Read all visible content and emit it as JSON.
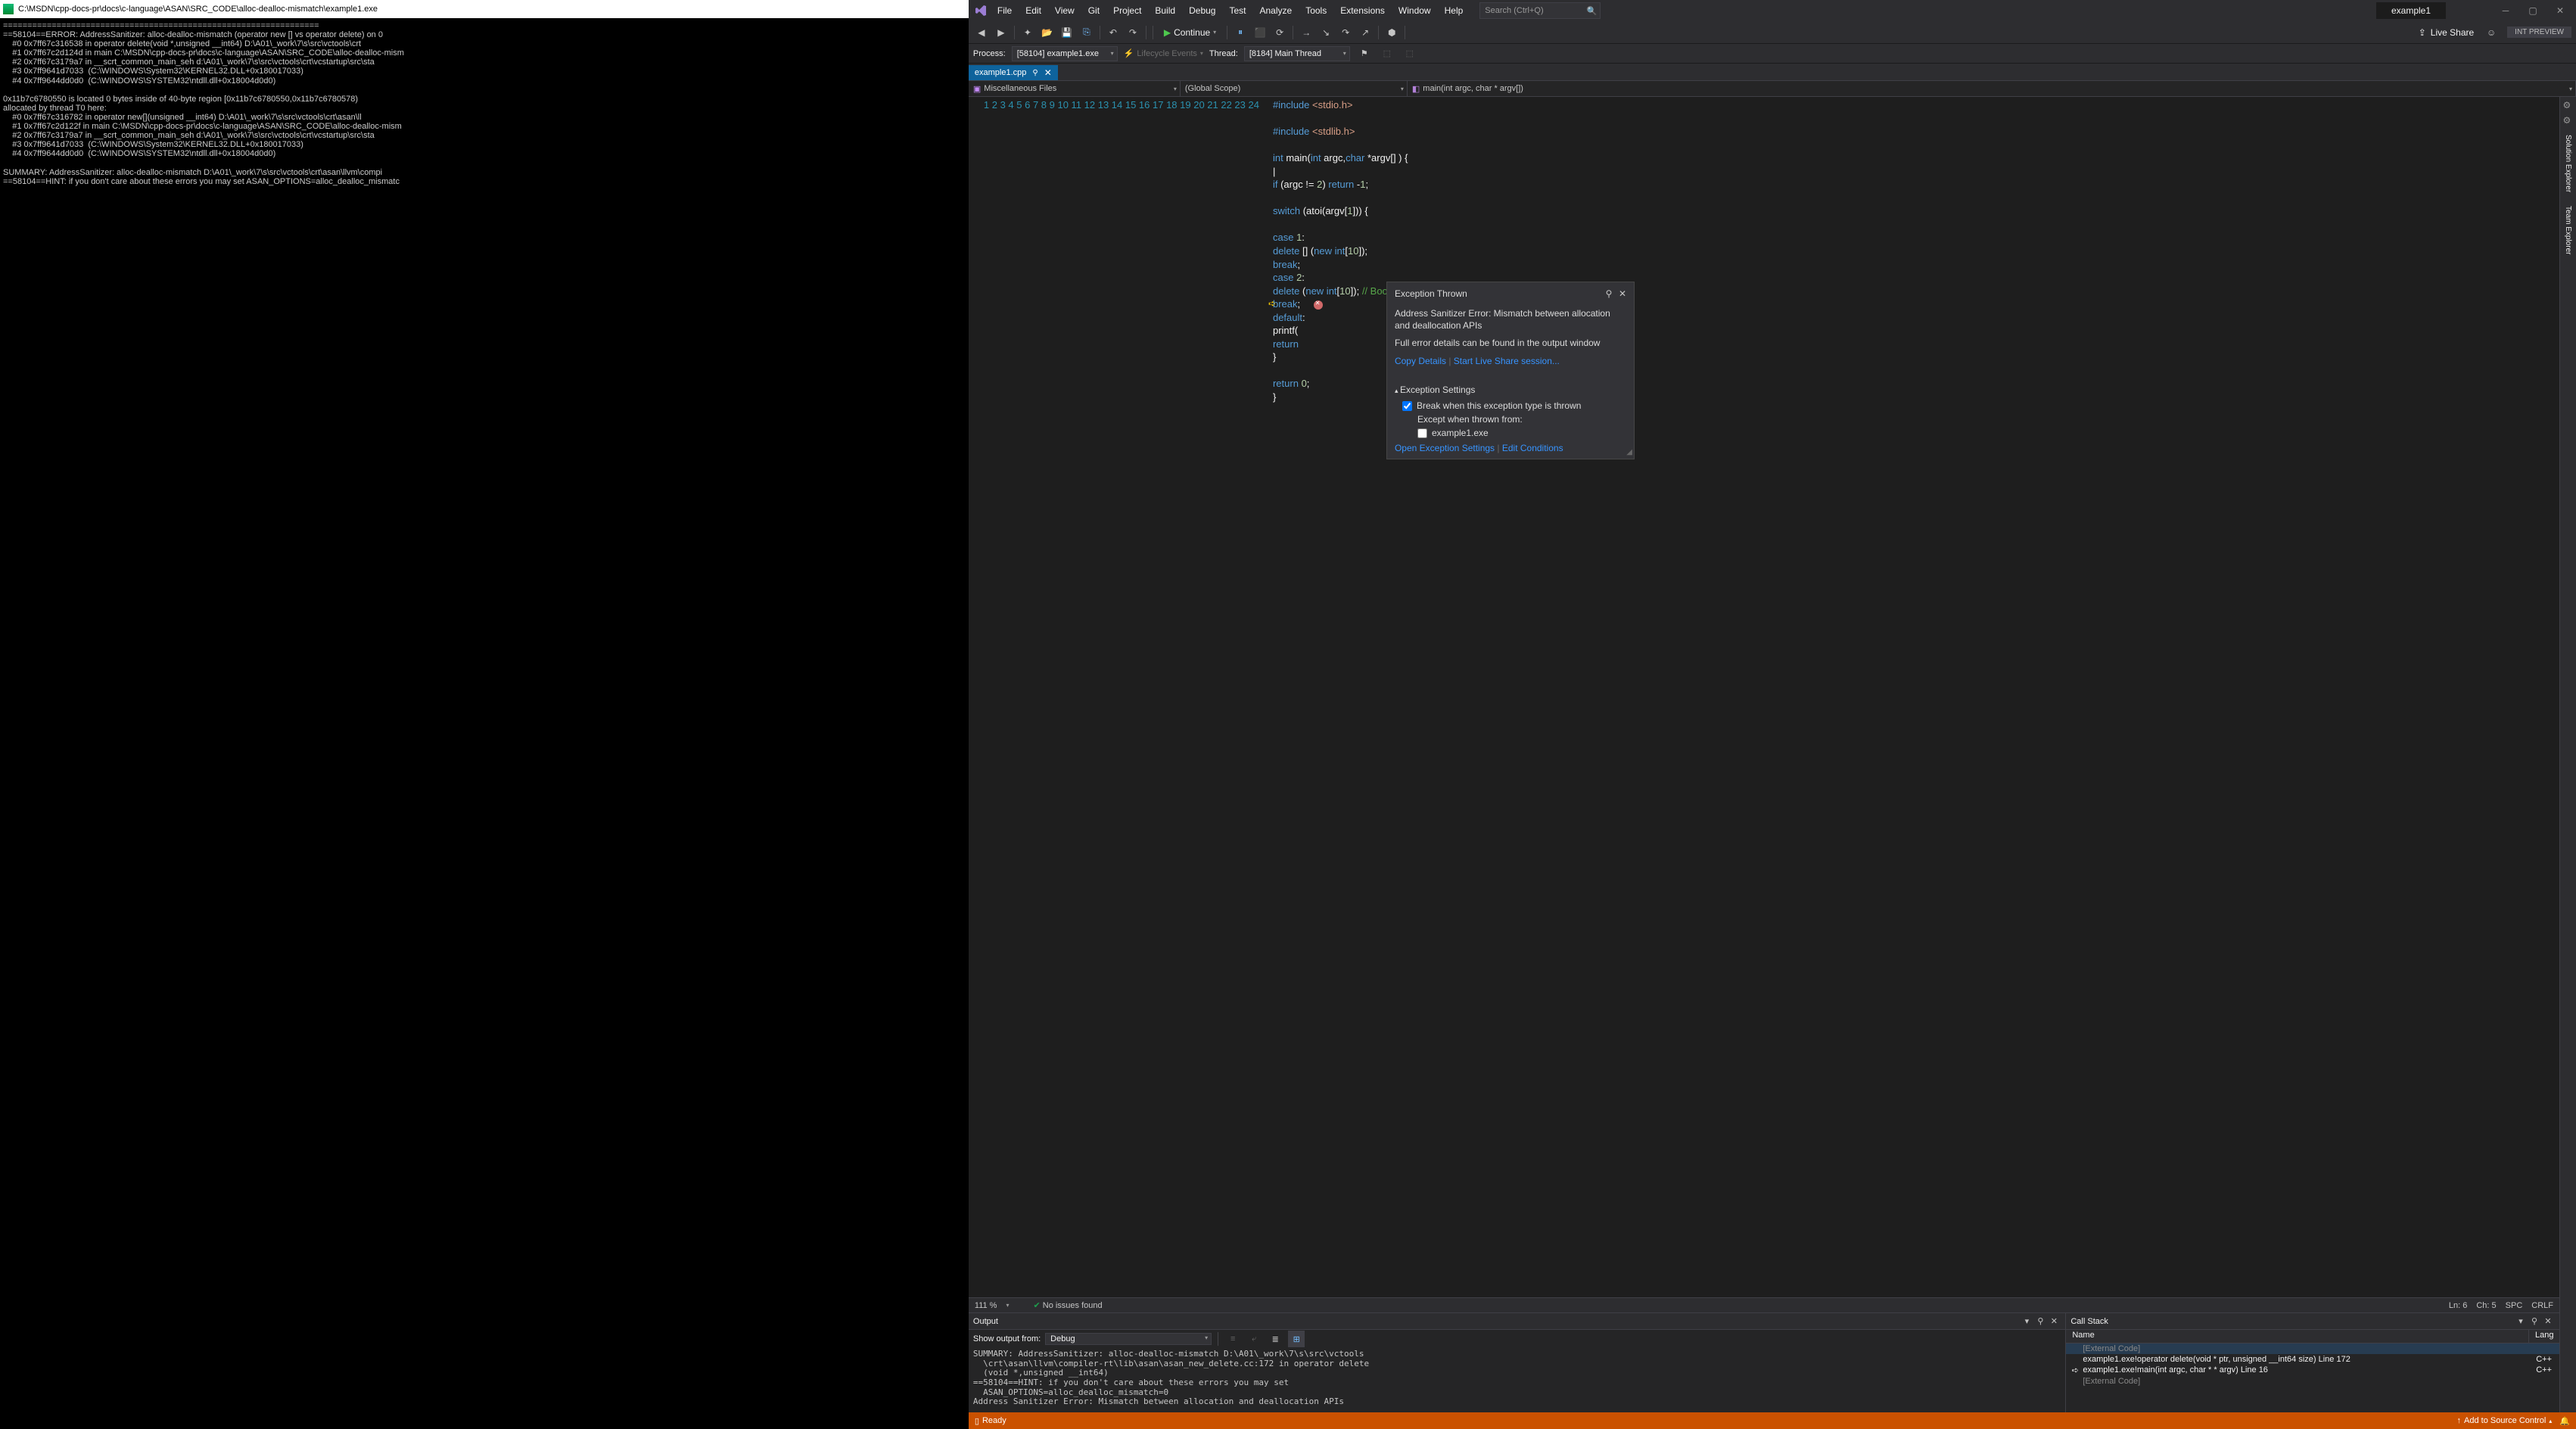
{
  "console": {
    "title": "C:\\MSDN\\cpp-docs-pr\\docs\\c-language\\ASAN\\SRC_CODE\\alloc-dealloc-mismatch\\example1.exe",
    "body": "=================================================================\n==58104==ERROR: AddressSanitizer: alloc-dealloc-mismatch (operator new [] vs operator delete) on 0\n    #0 0x7ff67c316538 in operator delete(void *,unsigned __int64) D:\\A01\\_work\\7\\s\\src\\vctools\\crt\n    #1 0x7ff67c2d124d in main C:\\MSDN\\cpp-docs-pr\\docs\\c-language\\ASAN\\SRC_CODE\\alloc-dealloc-mism\n    #2 0x7ff67c3179a7 in __scrt_common_main_seh d:\\A01\\_work\\7\\s\\src\\vctools\\crt\\vcstartup\\src\\sta\n    #3 0x7ff9641d7033  (C:\\WINDOWS\\System32\\KERNEL32.DLL+0x180017033)\n    #4 0x7ff9644dd0d0  (C:\\WINDOWS\\SYSTEM32\\ntdll.dll+0x18004d0d0)\n\n0x11b7c6780550 is located 0 bytes inside of 40-byte region [0x11b7c6780550,0x11b7c6780578)\nallocated by thread T0 here:\n    #0 0x7ff67c316782 in operator new[](unsigned __int64) D:\\A01\\_work\\7\\s\\src\\vctools\\crt\\asan\\ll\n    #1 0x7ff67c2d122f in main C:\\MSDN\\cpp-docs-pr\\docs\\c-language\\ASAN\\SRC_CODE\\alloc-dealloc-mism\n    #2 0x7ff67c3179a7 in __scrt_common_main_seh d:\\A01\\_work\\7\\s\\src\\vctools\\crt\\vcstartup\\src\\sta\n    #3 0x7ff9641d7033  (C:\\WINDOWS\\System32\\KERNEL32.DLL+0x180017033)\n    #4 0x7ff9644dd0d0  (C:\\WINDOWS\\SYSTEM32\\ntdll.dll+0x18004d0d0)\n\nSUMMARY: AddressSanitizer: alloc-dealloc-mismatch D:\\A01\\_work\\7\\s\\src\\vctools\\crt\\asan\\llvm\\compi\n==58104==HINT: if you don't care about these errors you may set ASAN_OPTIONS=alloc_dealloc_mismatc"
  },
  "menu": {
    "items": [
      "File",
      "Edit",
      "View",
      "Git",
      "Project",
      "Build",
      "Debug",
      "Test",
      "Analyze",
      "Tools",
      "Extensions",
      "Window",
      "Help"
    ],
    "search_placeholder": "Search (Ctrl+Q)",
    "solution_name": "example1"
  },
  "toolbar": {
    "continue_label": "Continue",
    "liveshare_label": "Live Share",
    "intpreview_label": "INT PREVIEW"
  },
  "processbar": {
    "process_label": "Process:",
    "process_value": "[58104] example1.exe",
    "lifecycle_label": "Lifecycle Events",
    "thread_label": "Thread:",
    "thread_value": "[8184] Main Thread"
  },
  "tab": {
    "filename": "example1.cpp"
  },
  "context": {
    "project": "Miscellaneous Files",
    "scope": "(Global Scope)",
    "function": "main(int argc, char * argv[])"
  },
  "code": {
    "lines": [
      {
        "n": 1,
        "html": "<span class='kw'>#include</span> <span class='str'>&lt;stdio.h&gt;</span>"
      },
      {
        "n": 2,
        "html": ""
      },
      {
        "n": 3,
        "html": "<span class='kw'>#include</span> <span class='str'>&lt;stdlib.h&gt;</span>"
      },
      {
        "n": 4,
        "html": ""
      },
      {
        "n": 5,
        "html": "<span class='kw'>int</span> main(<span class='kw'>int</span> argc,<span class='kw'>char</span> *argv[] ) {"
      },
      {
        "n": 6,
        "html": "  |"
      },
      {
        "n": 7,
        "html": "    <span class='kw'>if</span> (argc != <span class='num'>2</span>) <span class='kw'>return</span> -<span class='num'>1</span>;"
      },
      {
        "n": 8,
        "html": ""
      },
      {
        "n": 9,
        "html": "    <span class='kw'>switch</span> (atoi(argv[<span class='num'>1</span>])) {"
      },
      {
        "n": 10,
        "html": ""
      },
      {
        "n": 11,
        "html": "    <span class='kw'>case</span> <span class='num'>1</span>:"
      },
      {
        "n": 12,
        "html": "        <span class='kw'>delete</span> [] (<span class='kw'>new int</span>[<span class='num'>10</span>]);"
      },
      {
        "n": 13,
        "html": "        <span class='kw'>break</span>;"
      },
      {
        "n": 14,
        "html": "    <span class='kw'>case</span> <span class='num'>2</span>:"
      },
      {
        "n": 15,
        "html": "        <span class='kw'>delete</span> (<span class='kw'>new int</span>[<span class='num'>10</span>]);      <span class='cmt'>// Boom!</span>"
      },
      {
        "n": 16,
        "html": "        <span class='kw'>break</span>;  <span class='err-stop' data-name='error-stop-icon' data-interactable='false'></span>"
      },
      {
        "n": 17,
        "html": "    <span class='kw'>default</span>:"
      },
      {
        "n": 18,
        "html": "        printf("
      },
      {
        "n": 19,
        "html": "        <span class='kw'>return</span>"
      },
      {
        "n": 20,
        "html": "    }"
      },
      {
        "n": 21,
        "html": ""
      },
      {
        "n": 22,
        "html": "    <span class='kw'>return</span> <span class='num'>0</span>;"
      },
      {
        "n": 23,
        "html": "}"
      },
      {
        "n": 24,
        "html": ""
      }
    ]
  },
  "exc": {
    "title": "Exception Thrown",
    "msg1": "Address Sanitizer Error: Mismatch between allocation and deallocation APIs",
    "msg2": "Full error details can be found in the output window",
    "copy": "Copy Details",
    "liveshare": "Start Live Share session...",
    "settings_title": "Exception Settings",
    "break_label": "Break when this exception type is thrown",
    "except_label": "Except when thrown from:",
    "module": "example1.exe",
    "open_settings": "Open Exception Settings",
    "edit_cond": "Edit Conditions"
  },
  "editstatus": {
    "zoom": "111 %",
    "issues": "No issues found",
    "ln": "Ln: 6",
    "col": "Ch: 5",
    "spc": "SPC",
    "crlf": "CRLF"
  },
  "output": {
    "title": "Output",
    "show_from": "Show output from:",
    "source": "Debug",
    "body": "SUMMARY: AddressSanitizer: alloc-dealloc-mismatch D:\\A01\\_work\\7\\s\\src\\vctools\n  \\crt\\asan\\llvm\\compiler-rt\\lib\\asan\\asan_new_delete.cc:172 in operator delete\n  (void *,unsigned __int64)\n==58104==HINT: if you don't care about these errors you may set\n  ASAN_OPTIONS=alloc_dealloc_mismatch=0\nAddress Sanitizer Error: Mismatch between allocation and deallocation APIs"
  },
  "callstack": {
    "title": "Call Stack",
    "col_name": "Name",
    "col_lang": "Lang",
    "rows": [
      {
        "ic": "",
        "name": "[External Code]",
        "lang": "",
        "dim": true,
        "sel": true
      },
      {
        "ic": "",
        "name": "example1.exe!operator delete(void * ptr, unsigned __int64 size) Line 172",
        "lang": "C++"
      },
      {
        "ic": "➪",
        "name": "example1.exe!main(int argc, char * * argv) Line 16",
        "lang": "C++"
      },
      {
        "ic": "",
        "name": "[External Code]",
        "lang": "",
        "dim": true
      }
    ]
  },
  "sidetabs": {
    "solution": "Solution Explorer",
    "team": "Team Explorer"
  },
  "status": {
    "ready": "Ready",
    "add_source": "Add to Source Control"
  }
}
